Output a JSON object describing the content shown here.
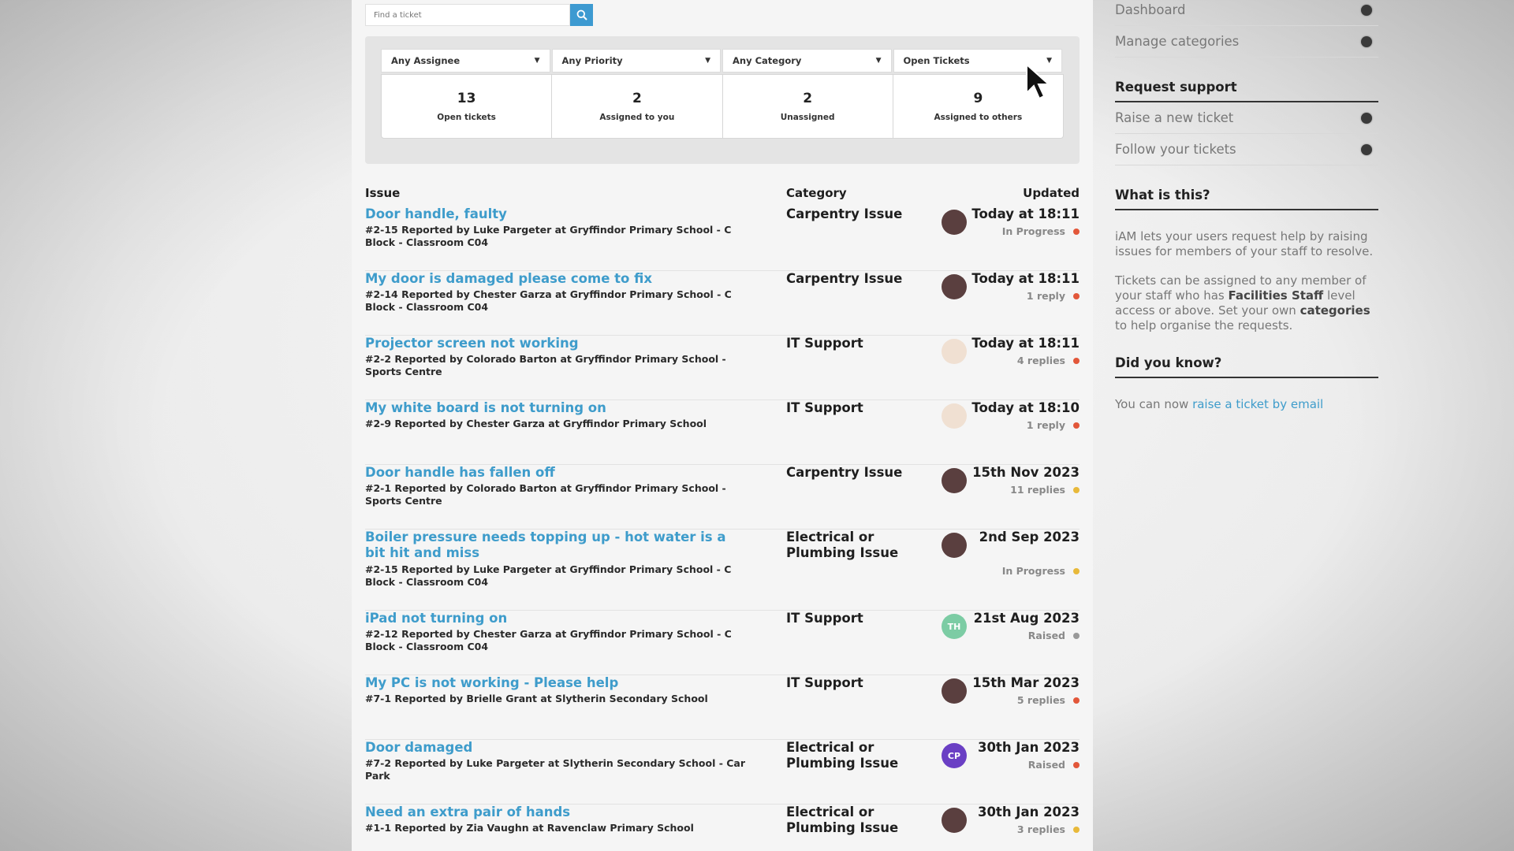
{
  "search": {
    "placeholder": "Find a ticket"
  },
  "filters": [
    {
      "label": "Any Assignee"
    },
    {
      "label": "Any Priority"
    },
    {
      "label": "Any Category"
    },
    {
      "label": "Open Tickets"
    }
  ],
  "stats": [
    {
      "value": "13",
      "label": "Open tickets"
    },
    {
      "value": "2",
      "label": "Assigned to you"
    },
    {
      "value": "2",
      "label": "Unassigned"
    },
    {
      "value": "9",
      "label": "Assigned to others"
    }
  ],
  "table": {
    "headers": {
      "issue": "Issue",
      "category": "Category",
      "updated": "Updated"
    },
    "rows": [
      {
        "title": "Door handle, faulty",
        "meta": "#2-15 Reported by Luke Pargeter at Gryffindor Primary School - C Block - Classroom C04",
        "category": "Carpentry Issue",
        "avatar": "",
        "avatar_color": "#5a3f3f",
        "updated": "Today at 18:11",
        "status": "In Progress",
        "dot_color": "#e2573a"
      },
      {
        "title": "My door is damaged please come to fix",
        "meta": "#2-14 Reported by Chester Garza at Gryffindor Primary School - C Block - Classroom C04",
        "category": "Carpentry Issue",
        "avatar": "",
        "avatar_color": "#5a3f3f",
        "updated": "Today at 18:11",
        "status": "1 reply",
        "dot_color": "#e2573a"
      },
      {
        "title": "Projector screen not working",
        "meta": "#2-2 Reported by Colorado Barton at Gryffindor Primary School - Sports Centre",
        "category": "IT Support",
        "avatar": "",
        "avatar_color": "#f0e0d2",
        "updated": "Today at 18:11",
        "status": "4 replies",
        "dot_color": "#e2573a"
      },
      {
        "title": "My white board is not turning on",
        "meta": "#2-9 Reported by Chester Garza at Gryffindor Primary School",
        "category": "IT Support",
        "avatar": "",
        "avatar_color": "#f0e0d2",
        "updated": "Today at 18:10",
        "status": "1 reply",
        "dot_color": "#e2573a"
      },
      {
        "title": "Door handle has fallen off",
        "meta": "#2-1 Reported by Colorado Barton at Gryffindor Primary School - Sports Centre",
        "category": "Carpentry Issue",
        "avatar": "",
        "avatar_color": "#5a3f3f",
        "updated": "15th Nov 2023",
        "status": "11 replies",
        "dot_color": "#e8b93a"
      },
      {
        "title": "Boiler pressure needs topping up - hot water is a bit hit and miss",
        "meta": "#2-15 Reported by Luke Pargeter at Gryffindor Primary School - C Block - Classroom C04",
        "category": "Electrical or Plumbing Issue",
        "avatar": "",
        "avatar_color": "#5a3f3f",
        "updated": "2nd Sep 2023",
        "status": "In Progress",
        "dot_color": "#e8b93a",
        "tall": true
      },
      {
        "title": "iPad not turning on",
        "meta": "#2-12 Reported by Chester Garza at Gryffindor Primary School - C Block - Classroom C04",
        "category": "IT Support",
        "avatar": "TH",
        "avatar_color": "#7ccca4",
        "updated": "21st Aug 2023",
        "status": "Raised",
        "dot_color": "#999999"
      },
      {
        "title": "My PC is not working - Please help",
        "meta": "#7-1 Reported by Brielle Grant at Slytherin Secondary School",
        "category": "IT Support",
        "avatar": "",
        "avatar_color": "#5a3f3f",
        "updated": "15th Mar 2023",
        "status": "5 replies",
        "dot_color": "#e2573a"
      },
      {
        "title": "Door damaged",
        "meta": "#7-2 Reported by Luke Pargeter at Slytherin Secondary School - Car Park",
        "category": "Electrical or Plumbing Issue",
        "avatar": "CP",
        "avatar_color": "#6a3fc4",
        "updated": "30th Jan 2023",
        "status": "Raised",
        "dot_color": "#e2573a"
      },
      {
        "title": "Need an extra pair of hands",
        "meta": "#1-1 Reported by Zia Vaughn at Ravenclaw Primary School",
        "category": "Electrical or Plumbing Issue",
        "avatar": "",
        "avatar_color": "#5a3f3f",
        "updated": "30th Jan 2023",
        "status": "3 replies",
        "dot_color": "#e8b93a"
      }
    ]
  },
  "sidebar": {
    "links_top": [
      {
        "label": "Dashboard"
      },
      {
        "label": "Manage categories"
      }
    ],
    "request_heading": "Request support",
    "links_request": [
      {
        "label": "Raise a new ticket"
      },
      {
        "label": "Follow your tickets"
      }
    ],
    "what_heading": "What is this?",
    "what_p1": "iAM lets your users request help by raising issues for members of your staff to resolve.",
    "what_p2_a": "Tickets can be assigned to any member of your staff who has ",
    "what_p2_b": "Facilities Staff",
    "what_p2_c": " level access or above. Set your own ",
    "what_p2_d": "categories",
    "what_p2_e": " to help organise the requests.",
    "know_heading": "Did you know?",
    "know_text": "You can now ",
    "know_link": "raise a ticket by email"
  },
  "colors": {
    "accent": "#3e9ccb",
    "search_button": "#3d9ad1"
  }
}
